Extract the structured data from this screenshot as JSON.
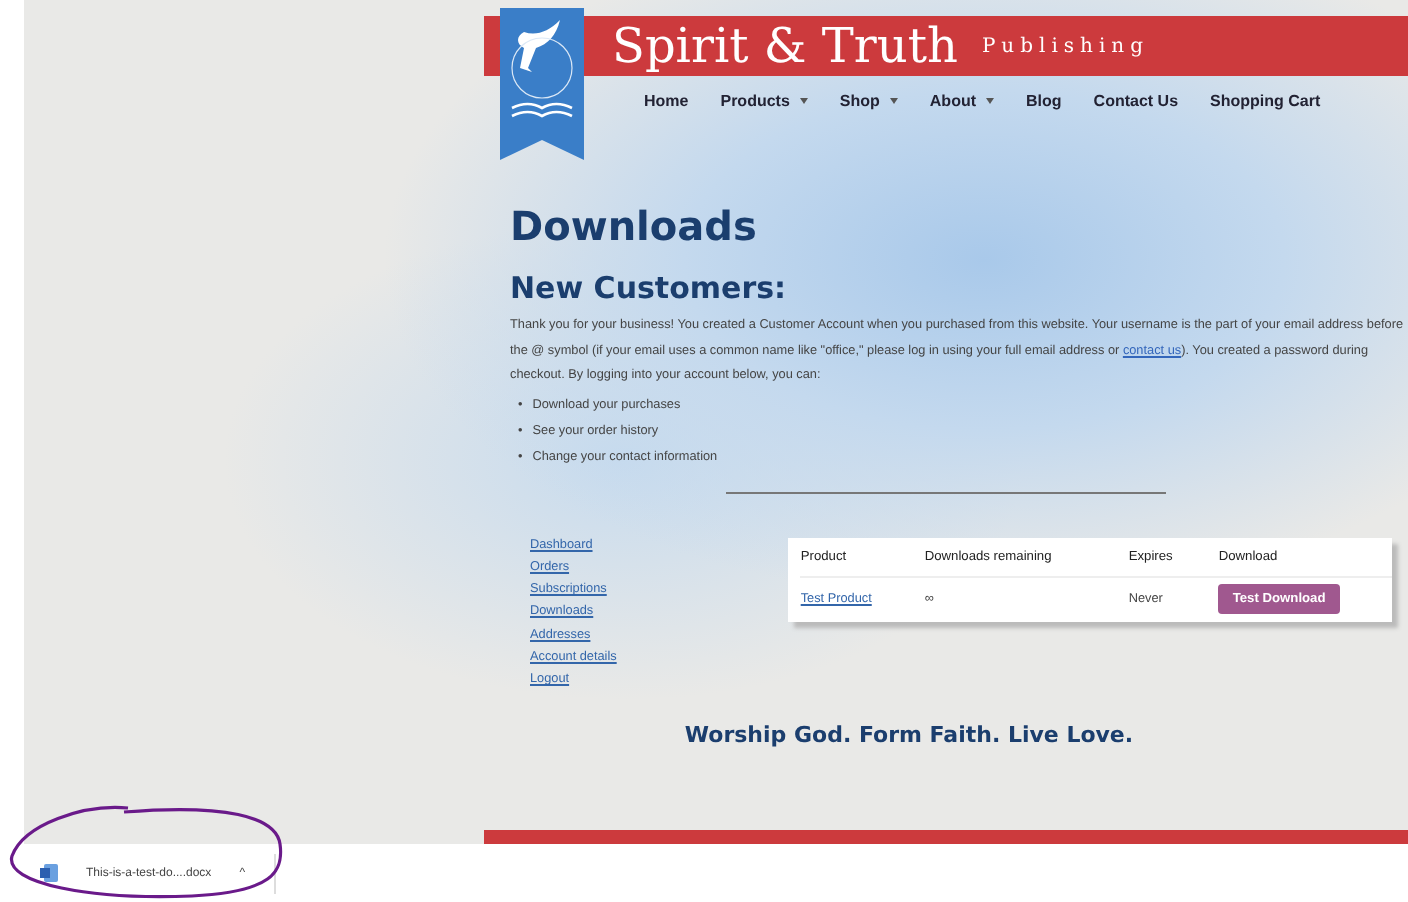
{
  "header": {
    "title": "Spirit & Truth",
    "subtitle": "Publishing"
  },
  "nav": [
    {
      "label": "Home",
      "dropdown": false
    },
    {
      "label": "Products",
      "dropdown": true
    },
    {
      "label": "Shop",
      "dropdown": true
    },
    {
      "label": "About",
      "dropdown": true
    },
    {
      "label": "Blog",
      "dropdown": false
    },
    {
      "label": "Contact Us",
      "dropdown": false
    },
    {
      "label": "Shopping Cart",
      "dropdown": false
    }
  ],
  "page_title": "Downloads",
  "section_title": "New Customers:",
  "intro": {
    "before": "Thank you for your business! You created a Customer Account when you purchased from this website. Your username is the part of your email address before the @ symbol (if your email uses a common name like \"office,\" please log in using your full email address or ",
    "link": "contact us",
    "after": "). You created a password during checkout. By logging into your account below, you can:"
  },
  "bullets": [
    {
      "marker": "•",
      "text": "Download your purchases"
    },
    {
      "marker": "•",
      "text": "See your order history"
    },
    {
      "marker": "•",
      "text": "Change your contact information"
    }
  ],
  "account_menu": [
    "Dashboard",
    "Orders",
    "Subscriptions",
    "Downloads",
    "Addresses",
    "Account details",
    "Logout"
  ],
  "table": {
    "columns": [
      "Product",
      "Downloads remaining",
      "Expires",
      "Download"
    ],
    "rows": [
      {
        "product": "Test Product",
        "remaining": "∞",
        "expires": "Never",
        "action": "Test Download"
      }
    ]
  },
  "tagline": "Worship God. Form Faith. Live Love.",
  "download_bar": {
    "file": "This-is-a-test-do....docx",
    "caret": "^"
  }
}
